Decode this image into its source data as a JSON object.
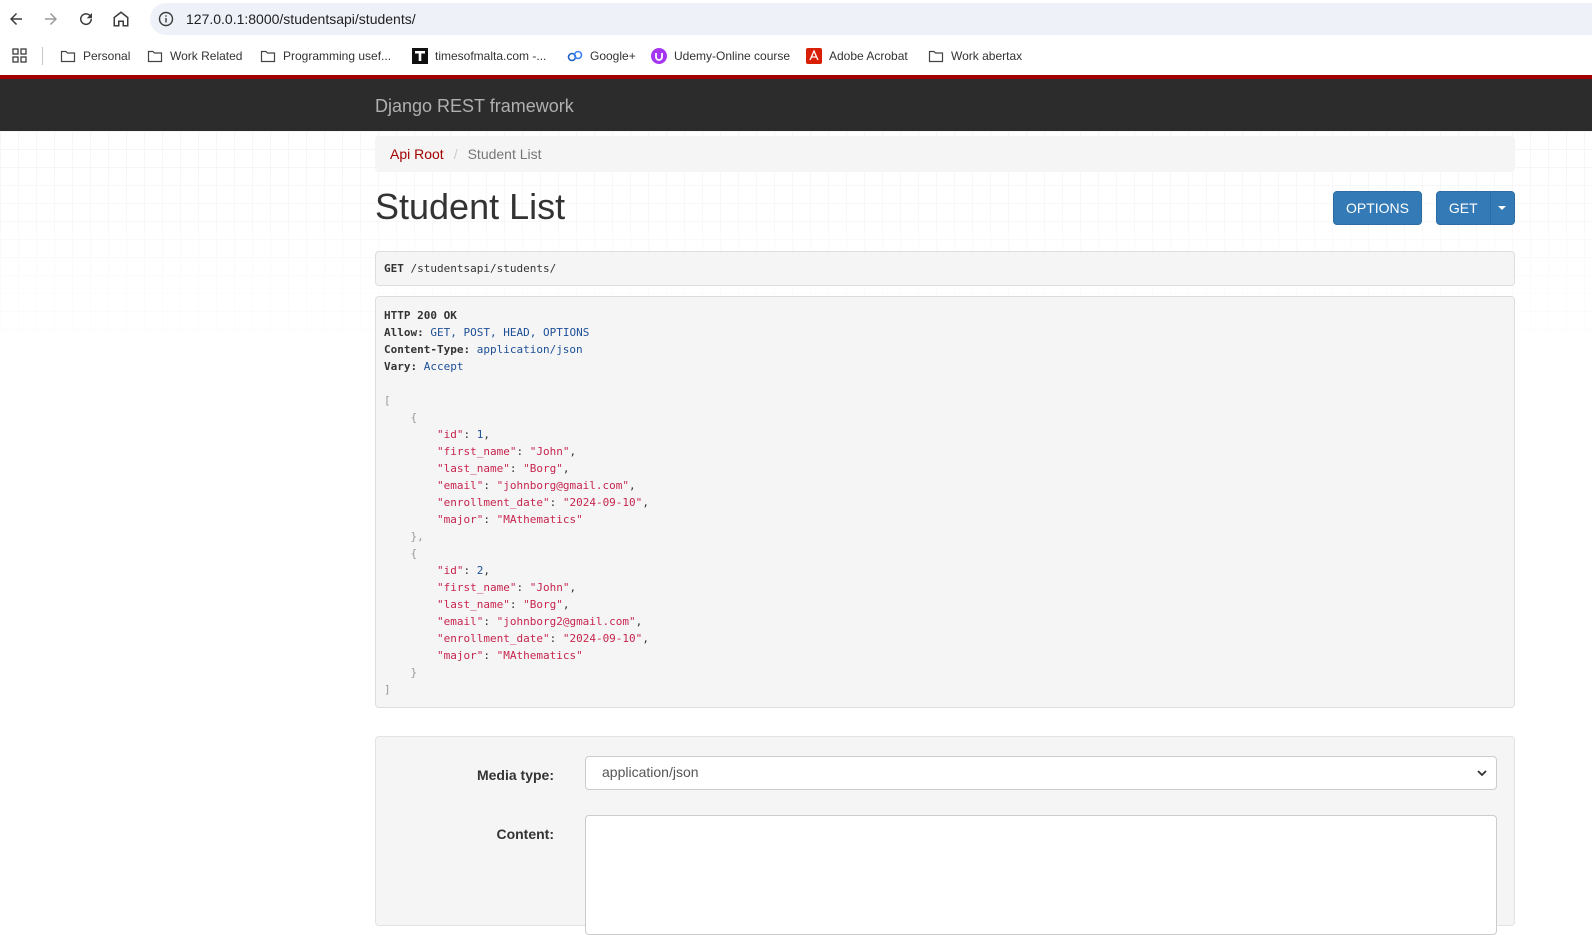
{
  "browser": {
    "url": "127.0.0.1:8000/studentsapi/students/",
    "bookmarks": [
      {
        "label": "Personal",
        "icon": "folder-icon"
      },
      {
        "label": "Work Related",
        "icon": "folder-icon"
      },
      {
        "label": "Programming usef...",
        "icon": "folder-icon"
      },
      {
        "label": "timesofmalta.com -...",
        "icon": "t-logo-icon"
      },
      {
        "label": "Google+",
        "icon": "google-plus-icon"
      },
      {
        "label": "Udemy-Online course",
        "icon": "udemy-icon"
      },
      {
        "label": "Adobe Acrobat",
        "icon": "acrobat-icon"
      },
      {
        "label": "Work abertax",
        "icon": "folder-icon"
      }
    ]
  },
  "drf": {
    "brand": "Django REST framework",
    "breadcrumb": {
      "root": "Api Root",
      "sep": "/",
      "current": "Student List"
    },
    "title": "Student List",
    "buttons": {
      "options": "OPTIONS",
      "get": "GET"
    },
    "request": {
      "method": "GET",
      "path": "/studentsapi/students/"
    },
    "response": {
      "status": "HTTP 200 OK",
      "headers": [
        {
          "name": "Allow:",
          "value": "GET, POST, HEAD, OPTIONS"
        },
        {
          "name": "Content-Type:",
          "value": "application/json"
        },
        {
          "name": "Vary:",
          "value": "Accept"
        }
      ],
      "students": [
        {
          "id": "1",
          "first_name": "\"John\"",
          "last_name": "\"Borg\"",
          "email": "\"johnborg@gmail.com\"",
          "enrollment_date": "\"2024-09-10\"",
          "major": "\"MAthematics\""
        },
        {
          "id": "2",
          "first_name": "\"John\"",
          "last_name": "\"Borg\"",
          "email": "\"johnborg2@gmail.com\"",
          "enrollment_date": "\"2024-09-10\"",
          "major": "\"MAthematics\""
        }
      ],
      "keys": {
        "id": "\"id\"",
        "first_name": "\"first_name\"",
        "last_name": "\"last_name\"",
        "email": "\"email\"",
        "enrollment_date": "\"enrollment_date\"",
        "major": "\"major\""
      }
    },
    "form": {
      "media_label": "Media type:",
      "media_value": "application/json",
      "content_label": "Content:"
    }
  },
  "colors": {
    "accent": "#a30000",
    "button": "#337ab7",
    "navbar": "#2c2c2c"
  }
}
